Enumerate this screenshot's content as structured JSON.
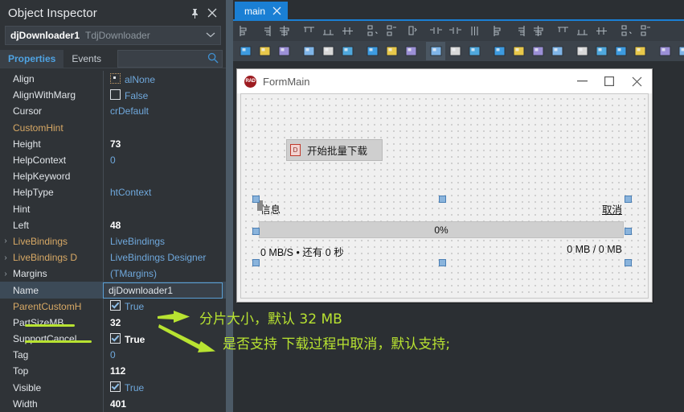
{
  "inspector": {
    "title": "Object Inspector",
    "pin_icon": "pin-icon",
    "close_icon": "close-icon",
    "component": {
      "name": "djDownloader1",
      "class": "TdjDownloader",
      "chevron": "⌄"
    },
    "tabs": [
      {
        "label": "Properties",
        "active": true
      },
      {
        "label": "Events",
        "active": false
      }
    ],
    "search": {
      "value": "",
      "placeholder": "",
      "icon": "search-icon"
    },
    "properties": [
      {
        "name": "Align",
        "value": "alNone",
        "kind": "dotbox",
        "expander": false,
        "sub": false,
        "bold": false
      },
      {
        "name": "AlignWithMarg",
        "value": "False",
        "kind": "checkbox",
        "checked": false,
        "expander": false,
        "sub": false,
        "bold": false
      },
      {
        "name": "Cursor",
        "value": "crDefault",
        "kind": "text",
        "expander": false,
        "sub": false,
        "bold": false
      },
      {
        "name": "CustomHint",
        "value": "",
        "kind": "text",
        "expander": false,
        "sub": true,
        "bold": false
      },
      {
        "name": "Height",
        "value": "73",
        "kind": "text",
        "expander": false,
        "sub": false,
        "bold": true
      },
      {
        "name": "HelpContext",
        "value": "0",
        "kind": "text",
        "expander": false,
        "sub": false,
        "bold": false
      },
      {
        "name": "HelpKeyword",
        "value": "",
        "kind": "text",
        "expander": false,
        "sub": false,
        "bold": false
      },
      {
        "name": "HelpType",
        "value": "htContext",
        "kind": "text",
        "expander": false,
        "sub": false,
        "bold": false
      },
      {
        "name": "Hint",
        "value": "",
        "kind": "text",
        "expander": false,
        "sub": false,
        "bold": false
      },
      {
        "name": "Left",
        "value": "48",
        "kind": "text",
        "expander": false,
        "sub": false,
        "bold": true
      },
      {
        "name": "LiveBindings",
        "value": "LiveBindings",
        "kind": "text",
        "expander": true,
        "sub": true,
        "bold": false
      },
      {
        "name": "LiveBindings D",
        "value": "LiveBindings Designer",
        "kind": "text",
        "expander": true,
        "sub": true,
        "bold": false
      },
      {
        "name": "Margins",
        "value": "(TMargins)",
        "kind": "text",
        "expander": true,
        "sub": false,
        "bold": false
      },
      {
        "name": "Name",
        "value": "djDownloader1",
        "kind": "editing",
        "expander": false,
        "sub": false,
        "bold": false,
        "selected": true
      },
      {
        "name": "ParentCustomH",
        "value": "True",
        "kind": "checkbox",
        "checked": true,
        "expander": false,
        "sub": true,
        "bold": false
      },
      {
        "name": "PartSizeMB",
        "value": "32",
        "kind": "text",
        "expander": false,
        "sub": false,
        "bold": true,
        "highlighted": true
      },
      {
        "name": "SupportCancel",
        "value": "True",
        "kind": "checkbox",
        "checked": true,
        "expander": false,
        "sub": false,
        "bold": true,
        "highlighted": true
      },
      {
        "name": "Tag",
        "value": "0",
        "kind": "text",
        "expander": false,
        "sub": false,
        "bold": false
      },
      {
        "name": "Top",
        "value": "112",
        "kind": "text",
        "expander": false,
        "sub": false,
        "bold": true
      },
      {
        "name": "Visible",
        "value": "True",
        "kind": "checkbox",
        "checked": true,
        "expander": false,
        "sub": false,
        "bold": false
      },
      {
        "name": "Width",
        "value": "401",
        "kind": "text",
        "expander": false,
        "sub": false,
        "bold": true
      }
    ]
  },
  "editor": {
    "tab": {
      "label": "main",
      "close_icon": "close-icon"
    },
    "toolbar_row1_icons": [
      "align-left-icon",
      "align-right-icon",
      "align-center-horiz-icon",
      "align-top-icon",
      "align-bottom-icon",
      "align-middle-vert-icon",
      "align-space-equally-vert-icon",
      "align-space-equally-horiz-icon",
      "center-in-window-icon",
      "size-width-icon",
      "size-height-icon",
      "size-both-icon",
      "scale-icon",
      "tab-order-icon",
      "creation-order-icon",
      "flip-horizontal-icon",
      "flip-vertical-icon",
      "grid-snap-icon",
      "bring-to-front-icon",
      "send-to-back-icon"
    ],
    "toolbar_row2_icons": [
      "align-palette-icon",
      "form-left-panel-icon",
      "form-split-panel-icon",
      "bring-forward-icon",
      "send-backward-icon",
      "align-to-grid-icon",
      "snap-to-grid-icon",
      "show-grid-icon",
      "guidelines-icon",
      "lock-controls-icon",
      "grid-view-icon",
      "copy-icon",
      "paste-icon",
      "clone-component-icon",
      "component-select-icon",
      "field-list-icon",
      "checkerboard-icon",
      "wrench-icon",
      "debug-icon",
      "run-icon",
      "stop-icon",
      "save-icon",
      "anchor-icon",
      "layers-icon"
    ]
  },
  "form": {
    "title": "FormMain",
    "logo": "RAD",
    "minimize_icon": "minimize-icon",
    "maximize_icon": "maximize-icon",
    "close_icon": "close-icon",
    "button_download": {
      "label": "开始批量下载",
      "glyph": "D"
    },
    "label_info": "信息",
    "link_cancel": "取消",
    "progress_text": "0%",
    "progress_percent": 0,
    "label_speed": "0 MB/S • 还有 0 秒",
    "label_size": "0 MB / 0 MB"
  },
  "annotations": [
    {
      "text": "分片大小，默认 32 MB"
    },
    {
      "text": "是否支持 下载过程中取消，默认支持;"
    }
  ],
  "colors": {
    "annotation": "#b8e331",
    "tab_active": "#1a7fd4",
    "panel_bg": "#2f3337",
    "selection": "#3c4a57"
  }
}
